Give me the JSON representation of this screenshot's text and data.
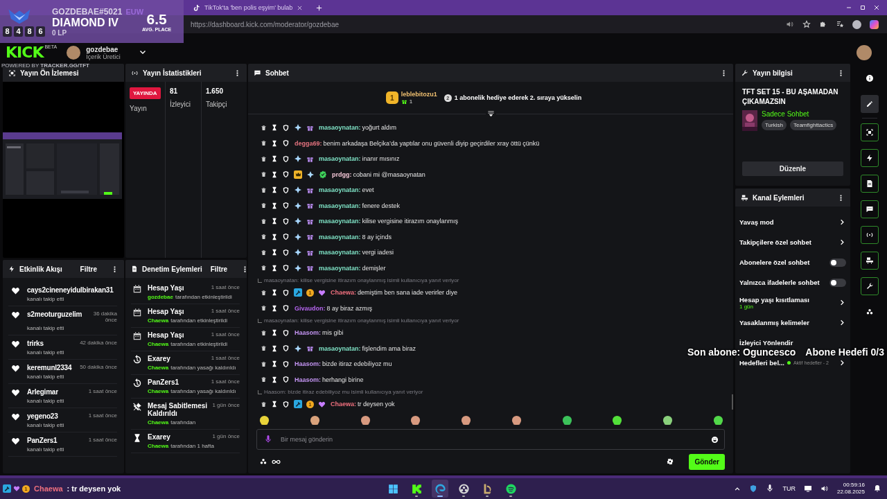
{
  "browser": {
    "tabs": [
      {
        "kind": "tiktok",
        "title": "TikTok'ta 'ben polis eşyim' bulab"
      }
    ],
    "url": "https://dashboard.kick.com/moderator/gozdebae"
  },
  "tft_overlay": {
    "riot_id": "GOZDEBAE#5021",
    "region": "EUW",
    "rank": "DIAMOND IV",
    "lp": "0 LP",
    "avg_place": "6.5",
    "avg_place_label": "AVG. PLACE",
    "recent_places": [
      "8",
      "4",
      "8",
      "6"
    ],
    "credit": "POWERED BY **TRACKER.GG/TFT**"
  },
  "header": {
    "logo": "KICK",
    "logo_badge": "BETA",
    "user": {
      "name": "gozdebae",
      "role": "İçerik Üretici"
    }
  },
  "preview": {
    "title": "Yayın Ön İzlemesi"
  },
  "stats": {
    "title": "Yayın İstatistikleri",
    "status": {
      "badge": "YAYINDA",
      "label": "Yayın"
    },
    "items": [
      {
        "value": "81",
        "label": "İzleyici"
      },
      {
        "value": "1.650",
        "label": "Takipçi"
      }
    ]
  },
  "activity": {
    "title": "Etkinlik Akışı",
    "filter": "Filtre",
    "items": [
      {
        "name": "cays2cineneyidulbirakan31",
        "action": "kanalı takip etti"
      },
      {
        "name": "s2meoturguzelim",
        "time": "36 dakika önce",
        "action": "kanalı takip etti"
      },
      {
        "name": "trirks",
        "time": "42 dakika önce",
        "action": "kanalı takip etti"
      },
      {
        "name": "keremunl2334",
        "time": "50 dakika önce",
        "action": "kanalı takip etti"
      },
      {
        "name": "Arlegimar",
        "time": "1 saat önce",
        "action": "kanalı takip etti"
      },
      {
        "name": "yegeno23",
        "time": "1 saat önce",
        "action": "kanalı takip etti"
      },
      {
        "name": "PanZers1",
        "time": "1 saat önce",
        "action": "kanalı takip etti"
      }
    ]
  },
  "moderation": {
    "title": "Denetim Eylemleri",
    "filter": "Filtre",
    "items": [
      {
        "kind": "calendar",
        "title": "Hesap Yaşı",
        "time": "1 saat önce",
        "actor": "gozdebae",
        "action": "tarafından etkinleştirildi"
      },
      {
        "kind": "calendar",
        "title": "Hesap Yaşı",
        "time": "1 saat önce",
        "actor": "Chaewa",
        "action": "tarafından etkinleştirildi"
      },
      {
        "kind": "calendar",
        "title": "Hesap Yaşı",
        "time": "1 saat önce",
        "actor": "Chaewa",
        "action": "tarafından etkinleştirildi"
      },
      {
        "kind": "unban",
        "title": "Exarey",
        "time": "1 saat önce",
        "actor": "Chaewa",
        "action": "tarafından yasağı kaldırıldı"
      },
      {
        "kind": "unban",
        "title": "PanZers1",
        "time": "1 saat önce",
        "actor": "Chaewa",
        "action": "tarafından yasağı kaldırıldı"
      },
      {
        "kind": "unpin",
        "title": "Mesaj Sabitlemesi Kaldırıldı",
        "time": "1 gün önce",
        "actor": "Chaewa",
        "action": "tarafından"
      },
      {
        "kind": "timeout",
        "title": "Exarey",
        "time": "1 gün önce",
        "actor": "Chaewa",
        "action": "tarafından 1 hafta"
      }
    ]
  },
  "chat": {
    "title": "Sohbet",
    "pinned": {
      "rank": "1",
      "user": "leblebitozu1",
      "gifts": "1",
      "next_rank": "2",
      "message": "1 abonelik hediye ederek 2. sıraya yükselin"
    },
    "messages": [
      {
        "kind": "message",
        "badges": [
          {
            "kind": "diamond"
          },
          {
            "kind": "gift"
          }
        ],
        "user": "masaoynatan:",
        "color": "#7fe3c6",
        "text": "yoğurt aldım"
      },
      {
        "kind": "message",
        "user": "degga69:",
        "color": "#e2727e",
        "text": "benim arkadaşa Belçika’da yaptılar onu güvenli diyip geçirdiler xray öttü çünkü"
      },
      {
        "kind": "message",
        "badges": [
          {
            "kind": "diamond"
          },
          {
            "kind": "gift"
          }
        ],
        "user": "masaoynatan:",
        "color": "#7fe3c6",
        "text": "inanır mısınız"
      },
      {
        "kind": "message",
        "badges": [
          {
            "kind": "crown"
          },
          {
            "kind": "diamond"
          },
          {
            "kind": "verified"
          }
        ],
        "user": "prdgg:",
        "color": "#f3c6d6",
        "text": "cobani mi @masaoynatan"
      },
      {
        "kind": "message",
        "badges": [
          {
            "kind": "diamond"
          },
          {
            "kind": "gift"
          }
        ],
        "user": "masaoynatan:",
        "color": "#7fe3c6",
        "text": "evet"
      },
      {
        "kind": "message",
        "badges": [
          {
            "kind": "diamond"
          },
          {
            "kind": "gift"
          }
        ],
        "user": "masaoynatan:",
        "color": "#7fe3c6",
        "text": "fenere destek"
      },
      {
        "kind": "message",
        "badges": [
          {
            "kind": "diamond"
          },
          {
            "kind": "gift"
          }
        ],
        "user": "masaoynatan:",
        "color": "#7fe3c6",
        "text": "kilise vergisine itirazım onaylanmış"
      },
      {
        "kind": "message",
        "badges": [
          {
            "kind": "diamond"
          },
          {
            "kind": "gift"
          }
        ],
        "user": "masaoynatan:",
        "color": "#7fe3c6",
        "text": "8 ay içinds"
      },
      {
        "kind": "message",
        "badges": [
          {
            "kind": "diamond"
          },
          {
            "kind": "gift"
          }
        ],
        "user": "masaoynatan:",
        "color": "#7fe3c6",
        "text": "vergi iadesi"
      },
      {
        "kind": "message",
        "badges": [
          {
            "kind": "diamond"
          },
          {
            "kind": "gift"
          }
        ],
        "user": "masaoynatan:",
        "color": "#7fe3c6",
        "text": "demişler"
      },
      {
        "kind": "reply",
        "text": "masaoynatan: kilise vergisine itirazım onaylanmış isimli kullanıcıya yanıt veriyor"
      },
      {
        "kind": "message",
        "badges": [
          {
            "kind": "moderator"
          },
          {
            "kind": "rank",
            "label": "1"
          },
          {
            "kind": "heart"
          }
        ],
        "user": "Chaewa:",
        "color": "#f0707e",
        "text": "demiştim ben sana iade verirler diye"
      },
      {
        "kind": "message",
        "user": "Givaudon:",
        "color": "#b565ef",
        "text": "8 ay biraz azmış"
      },
      {
        "kind": "reply",
        "text": "masaoynatan: kilise vergisine itirazım onaylanmış isimli kullanıcıya yanıt veriyor"
      },
      {
        "kind": "message",
        "user": "Haasom:",
        "color": "#c394f2",
        "text": "mis gibi"
      },
      {
        "kind": "message",
        "badges": [
          {
            "kind": "diamond"
          },
          {
            "kind": "gift"
          }
        ],
        "user": "masaoynatan:",
        "color": "#7fe3c6",
        "text": "fişlendim ama biraz"
      },
      {
        "kind": "message",
        "user": "Haasom:",
        "color": "#c394f2",
        "text": "bizde itiraz edebiliyoz mu"
      },
      {
        "kind": "message",
        "user": "Haasom:",
        "color": "#c394f2",
        "text": "herhangi birine"
      },
      {
        "kind": "reply",
        "text": "Haasom: bizde itiraz edebiliyoz mu isimli kullanıcıya yanıt veriyor"
      },
      {
        "kind": "message",
        "badges": [
          {
            "kind": "moderator"
          },
          {
            "kind": "rank",
            "label": "1"
          },
          {
            "kind": "heart"
          }
        ],
        "user": "Chaewa:",
        "color": "#f0707e",
        "text": "tr deysen yok"
      }
    ],
    "input": {
      "placeholder": "Bir mesaj gönderin"
    },
    "send": "Gönder"
  },
  "stream_info": {
    "title": "Yayın bilgisi",
    "stream_title": "TFT SET 15 - BU AŞAMADAN ÇIKAMAZSIN",
    "category": "Sadece Sohbet",
    "tags": [
      "Turkish",
      "Teamfighttactics"
    ],
    "edit": "Düzenle"
  },
  "channel_actions": {
    "title": "Kanal Eylemleri",
    "items": [
      {
        "kind": "link",
        "label": "Yavaş mod"
      },
      {
        "kind": "link",
        "label": "Takipçilere özel sohbet"
      },
      {
        "kind": "toggle",
        "label": "Abonelere özel sohbet",
        "on": false
      },
      {
        "kind": "toggle",
        "label": "Yalnızca ifadelerle sohbet",
        "on": false
      },
      {
        "kind": "link",
        "label": "Hesap yaşı kısıtlaması",
        "detail": "1 gün"
      },
      {
        "kind": "link",
        "label": "Yasaklanmış kelimeler"
      },
      {
        "kind": "plain",
        "label": "İzleyici Yönlendir"
      },
      {
        "kind": "goal",
        "label": "Hedefleri bel...",
        "detail": "Aktif hedefler - 2"
      }
    ]
  },
  "rail": [
    {
      "kind": "info",
      "active": false,
      "selected": false
    },
    {
      "kind": "edit",
      "active": false,
      "selected": true
    },
    {
      "kind": "preview",
      "active": true,
      "selected": false
    },
    {
      "kind": "bolt",
      "active": true,
      "selected": false
    },
    {
      "kind": "doc",
      "active": true,
      "selected": false
    },
    {
      "kind": "chat",
      "active": true,
      "selected": false
    },
    {
      "kind": "broadcast",
      "active": true,
      "selected": false
    },
    {
      "kind": "channel",
      "active": true,
      "selected": false
    },
    {
      "kind": "wrench",
      "active": true,
      "selected": false
    },
    {
      "kind": "dots",
      "active": false,
      "selected": false
    }
  ],
  "goal_overlay": {
    "last_sub": "Son abone: Oguncesco",
    "goal": "Abone Hedefi 0/3"
  },
  "chat_overlay": {
    "user": "Chaewa",
    "rank": "1",
    "text": ": tr deysen yok"
  },
  "taskbar": {
    "apps": [
      {
        "kind": "windows",
        "running": false,
        "selected": false
      },
      {
        "kind": "kick",
        "running": true,
        "selected": false
      },
      {
        "kind": "edge",
        "running": true,
        "selected": true
      },
      {
        "kind": "obs",
        "running": true,
        "selected": false
      },
      {
        "kind": "league",
        "running": true,
        "selected": false
      },
      {
        "kind": "spotify",
        "running": true,
        "selected": false
      }
    ],
    "language": "TUR",
    "time": "00:59:16",
    "date": "22.08.2025"
  }
}
